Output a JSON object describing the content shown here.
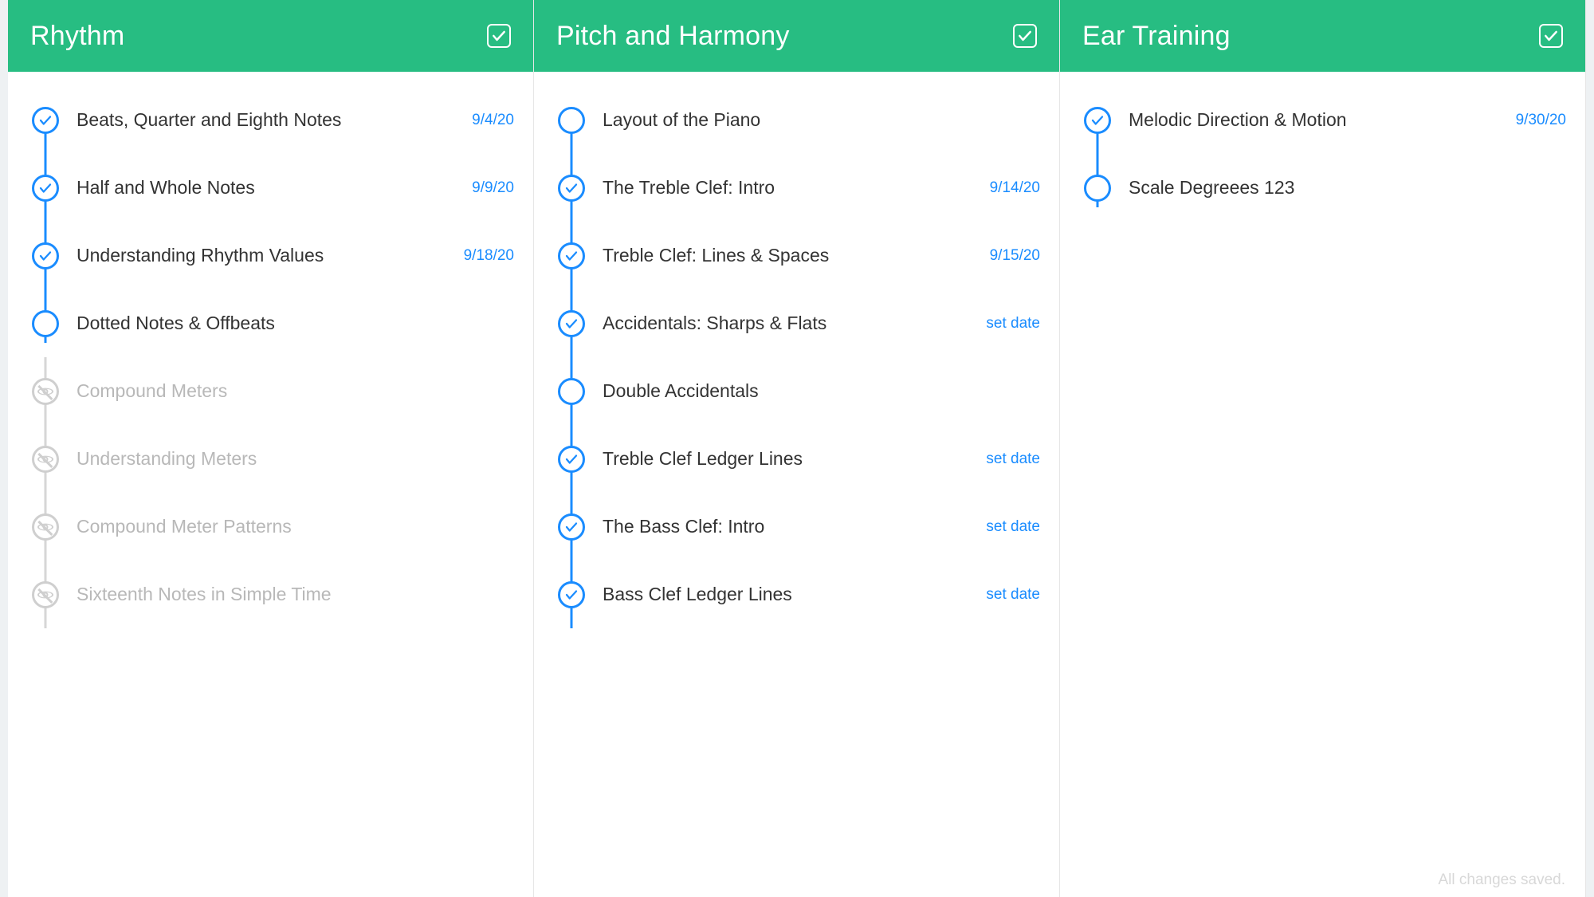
{
  "footer": {
    "saved": "All changes saved."
  },
  "columns": [
    {
      "title": "Rhythm",
      "items": [
        {
          "label": "Beats, Quarter and Eighth Notes",
          "date": "9/4/20",
          "state": "checked",
          "pos": "first"
        },
        {
          "label": "Half and Whole Notes",
          "date": "9/9/20",
          "state": "checked",
          "pos": "mid"
        },
        {
          "label": "Understanding Rhythm Values",
          "date": "9/18/20",
          "state": "checked",
          "pos": "mid"
        },
        {
          "label": "Dotted Notes & Offbeats",
          "date": "",
          "state": "open",
          "pos": "last"
        },
        {
          "label": "Compound Meters",
          "date": "",
          "state": "hidden",
          "pos": "inactive-first"
        },
        {
          "label": "Understanding Meters",
          "date": "",
          "state": "hidden",
          "pos": "inactive"
        },
        {
          "label": "Compound Meter Patterns",
          "date": "",
          "state": "hidden",
          "pos": "inactive"
        },
        {
          "label": "Sixteenth Notes in Simple Time",
          "date": "",
          "state": "hidden",
          "pos": "inactive"
        }
      ]
    },
    {
      "title": "Pitch and Harmony",
      "items": [
        {
          "label": "Layout of the Piano",
          "date": "",
          "state": "open",
          "pos": "first"
        },
        {
          "label": "The Treble Clef: Intro",
          "date": "9/14/20",
          "state": "checked",
          "pos": "mid"
        },
        {
          "label": "Treble Clef: Lines & Spaces",
          "date": "9/15/20",
          "state": "checked",
          "pos": "mid"
        },
        {
          "label": "Accidentals: Sharps & Flats",
          "date": "set date",
          "state": "checked",
          "pos": "mid"
        },
        {
          "label": "Double Accidentals",
          "date": "",
          "state": "open",
          "pos": "mid"
        },
        {
          "label": "Treble Clef Ledger Lines",
          "date": "set date",
          "state": "checked",
          "pos": "mid"
        },
        {
          "label": "The Bass Clef: Intro",
          "date": "set date",
          "state": "checked",
          "pos": "mid"
        },
        {
          "label": "Bass Clef Ledger Lines",
          "date": "set date",
          "state": "checked",
          "pos": "mid"
        }
      ]
    },
    {
      "title": "Ear Training",
      "items": [
        {
          "label": "Melodic Direction & Motion",
          "date": "9/30/20",
          "state": "checked",
          "pos": "first"
        },
        {
          "label": "Scale Degreees 123",
          "date": "",
          "state": "open",
          "pos": "last"
        }
      ]
    }
  ]
}
